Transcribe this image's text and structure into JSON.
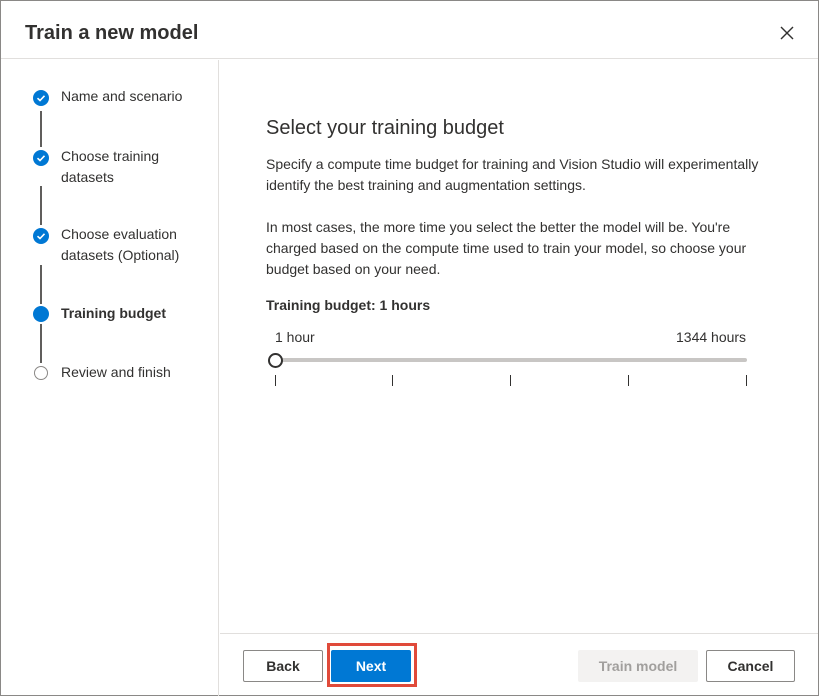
{
  "dialog": {
    "title": "Train a new model",
    "close_icon": "close-icon"
  },
  "steps": [
    {
      "label": "Name and scenario",
      "state": "done"
    },
    {
      "label": "Choose training datasets",
      "state": "done"
    },
    {
      "label": "Choose evaluation datasets (Optional)",
      "state": "done"
    },
    {
      "label": "Training budget",
      "state": "active"
    },
    {
      "label": "Review and finish",
      "state": "todo"
    }
  ],
  "main": {
    "heading": "Select your training budget",
    "paragraph1": "Specify a compute time budget for training and Vision Studio will experimentally identify the best training and augmentation settings.",
    "paragraph2": "In most cases, the more time you select the better the model will be. You're charged based on the compute time used to train your model, so choose your budget based on your need.",
    "budget_label": "Training budget: 1 hours",
    "slider": {
      "min_label": "1 hour",
      "max_label": "1344 hours",
      "value_fraction": 0
    }
  },
  "footer": {
    "back": "Back",
    "next": "Next",
    "train": "Train model",
    "cancel": "Cancel"
  },
  "colors": {
    "accent": "#0078d4",
    "highlight": "#e04a3a"
  }
}
